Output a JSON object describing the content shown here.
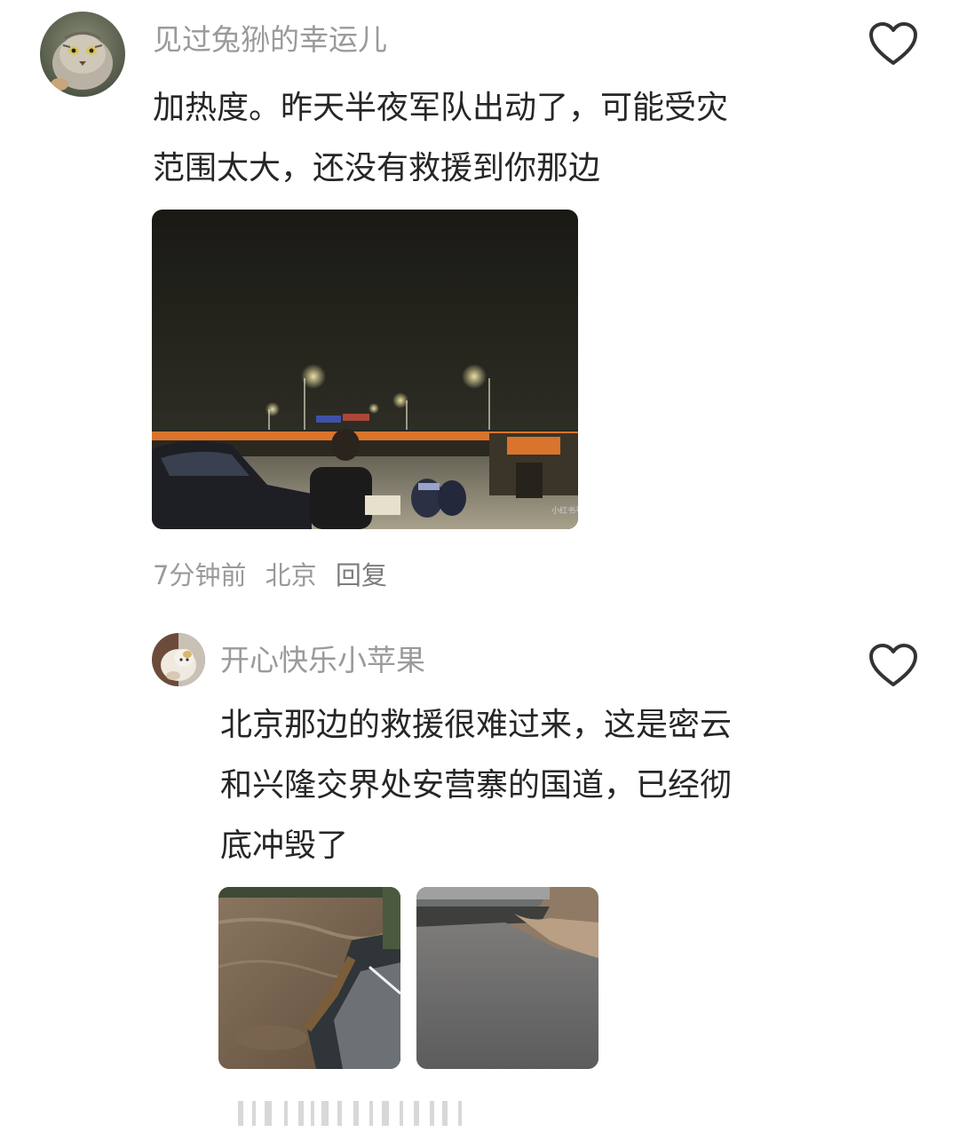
{
  "comments": [
    {
      "username": "见过兔狲的幸运儿",
      "avatar_icon": "pallas-cat-avatar",
      "text_lines": [
        "加热度。昨天半夜军队出动了，可能受灾",
        "范围太大，还没有救援到你那边"
      ],
      "photo": {
        "description_icon": "night-road-rescue-crowd-photo",
        "watermark": "小红书号"
      },
      "meta": {
        "time": "7分钟前",
        "location": "北京",
        "reply_label": "回复"
      }
    },
    {
      "username": "开心快乐小苹果",
      "avatar_icon": "cat-avatar",
      "text_lines": [
        "北京那边的救援很难过来，这是密云",
        "和兴隆交界处安营寨的国道，已经彻",
        "底冲毁了"
      ],
      "photos": [
        {
          "description_icon": "flooded-road-collapse-photo"
        },
        {
          "description_icon": "broken-asphalt-road-photo"
        }
      ]
    }
  ],
  "icons": {
    "like": "heart-outline-icon"
  },
  "colors": {
    "username": "#9a9a9a",
    "body_text": "#262626",
    "meta": "#9a9a9a"
  }
}
